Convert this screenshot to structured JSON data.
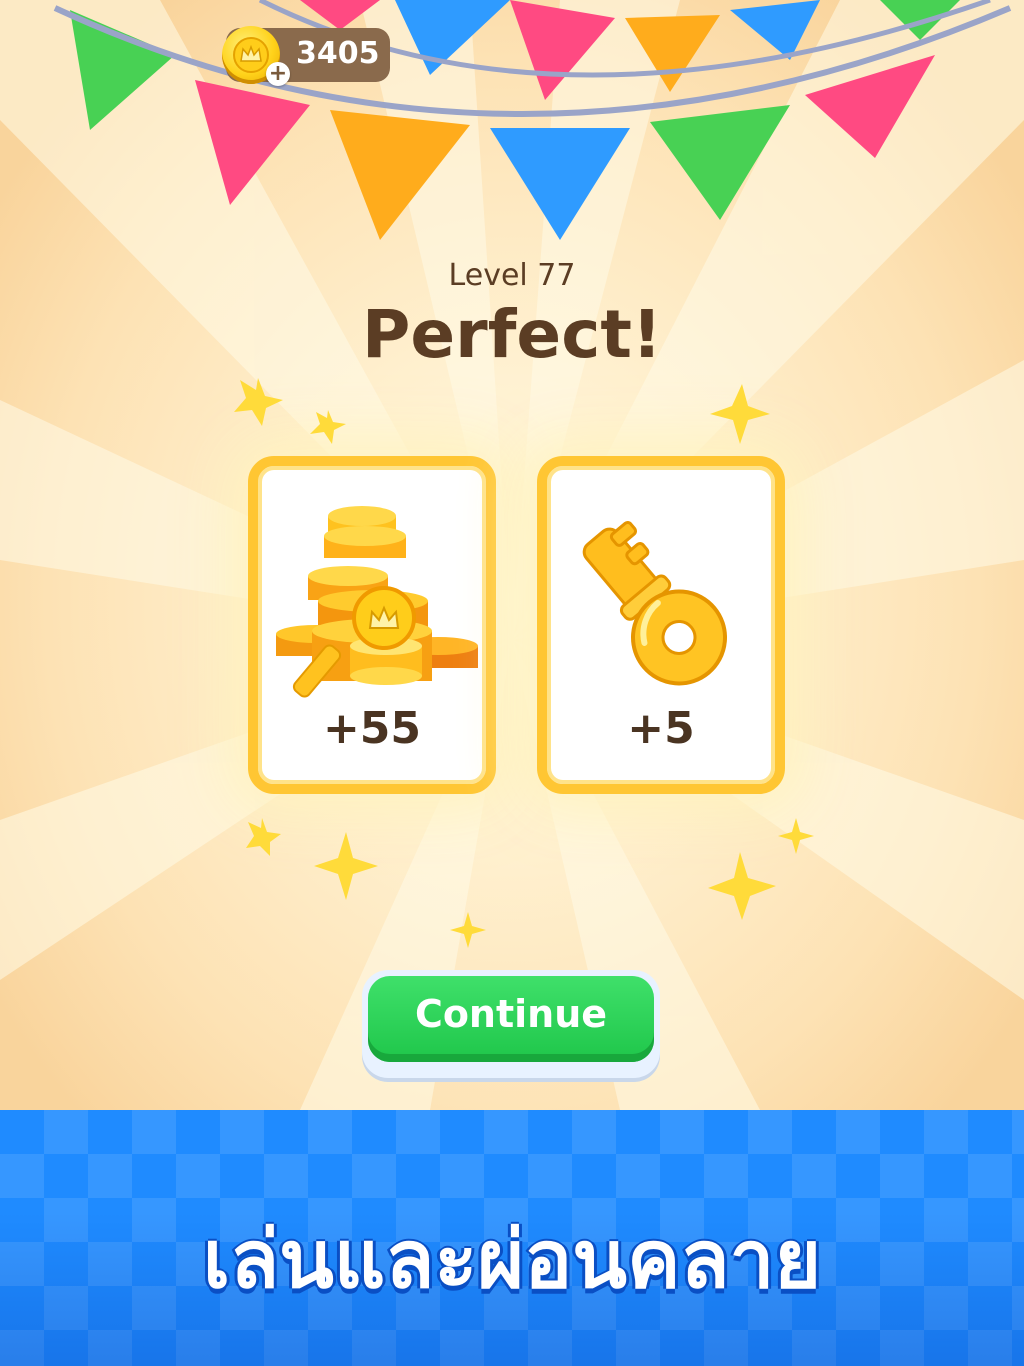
{
  "currency": {
    "amount": "3405",
    "icon": "crown-coin-icon",
    "add_icon": "plus-icon"
  },
  "result": {
    "level_label": "Level 77",
    "title": "Perfect!"
  },
  "rewards": [
    {
      "icon": "coin-pile-icon",
      "amount": "+55"
    },
    {
      "icon": "key-icon",
      "amount": "+5"
    }
  ],
  "continue_label": "Continue",
  "banner": {
    "tagline": "เล่นและผ่อนคลาย"
  },
  "colors": {
    "accent_green": "#22c84c",
    "banner_blue": "#1f8bff",
    "card_border": "#ffc633",
    "text_brown": "#5b3d24"
  }
}
